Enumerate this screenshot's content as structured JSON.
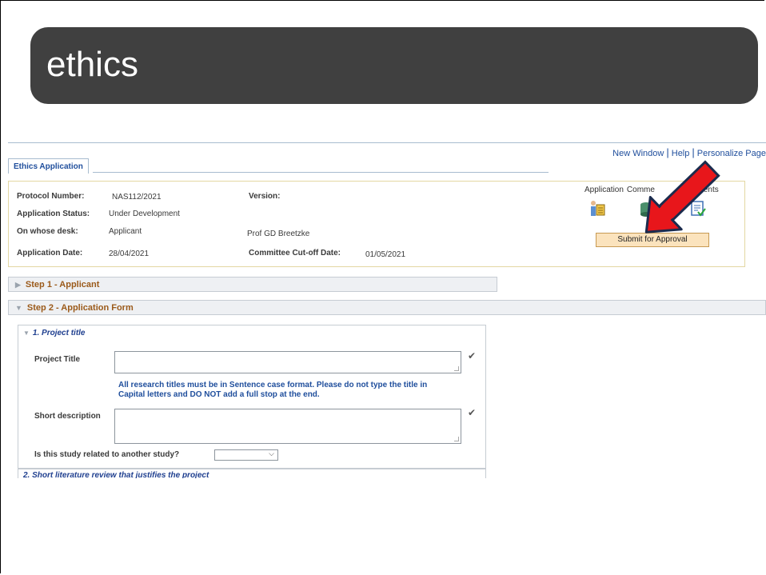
{
  "slide": {
    "title": "ethics"
  },
  "toplinks": {
    "new_window": "New Window",
    "help": "Help",
    "personalize": "Personalize Page"
  },
  "tab": {
    "label": "Ethics Application"
  },
  "header": {
    "protocol_label": "Protocol Number:",
    "protocol_value": "NAS112/2021",
    "version_label": "Version:",
    "status_label": "Application Status:",
    "status_value": "Under Development",
    "desk_label": "On whose desk:",
    "desk_value": "Applicant",
    "desk_person": "Prof GD Breetzke",
    "date_label": "Application Date:",
    "date_value": "28/04/2021",
    "cutoff_label": "Committee Cut-off Date:",
    "cutoff_value": "01/05/2021"
  },
  "actions": {
    "application_label": "Application",
    "comments_label": "Comme",
    "documents_label": "cuments",
    "submit_label": "Submit for Approval"
  },
  "steps": {
    "step1": "Step 1 - Applicant",
    "step2": "Step 2 - Application Form"
  },
  "form": {
    "section1_title": "1. Project title",
    "project_title_label": "Project Title",
    "project_title_value": "",
    "help_text": "All research titles must be in Sentence case format. Please do not type the title in Capital letters and DO NOT add a full stop at the end.",
    "short_desc_label": "Short description",
    "short_desc_value": "",
    "related_label": "Is this study related to another study?",
    "related_value": "",
    "section2_title": "2. Short literature review that justifies the project"
  },
  "colors": {
    "title_bar": "#404040",
    "link": "#1f4e9c",
    "step_text": "#9b5a1a",
    "submit_bg": "#fbe3bd",
    "arrow": "#e8161b"
  }
}
